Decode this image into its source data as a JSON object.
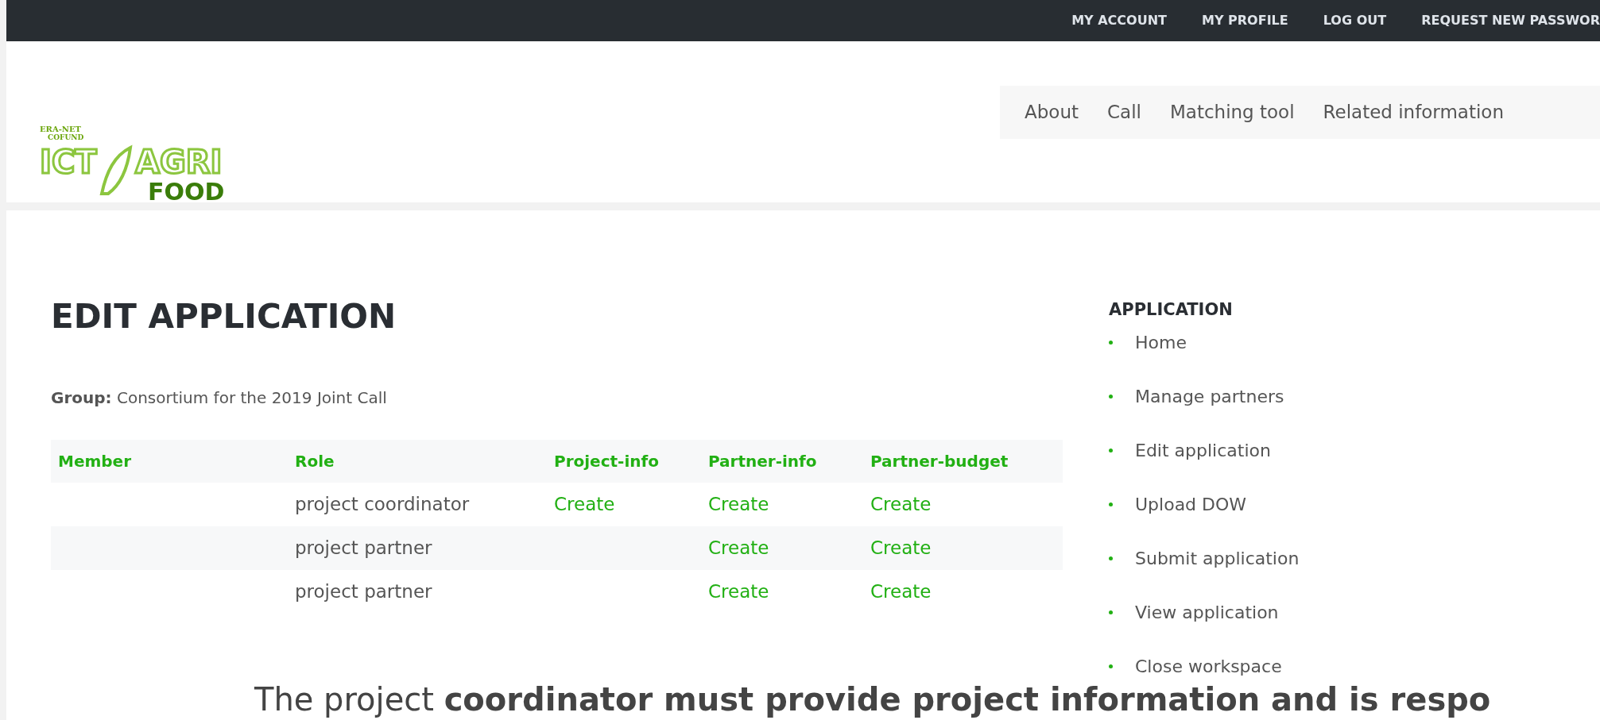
{
  "top_bar": {
    "links": [
      "MY ACCOUNT",
      "MY PROFILE",
      "LOG OUT",
      "REQUEST NEW PASSWOR"
    ]
  },
  "logo": {
    "small_lines": [
      "ERA-NET",
      "COFUND"
    ],
    "left": "ICT",
    "right": "AGRI",
    "bottom": "FOOD"
  },
  "nav": {
    "items": [
      "About",
      "Call",
      "Matching tool",
      "Related information"
    ]
  },
  "page": {
    "title": "EDIT APPLICATION",
    "group_label": "Group:",
    "group_value": "Consortium for the 2019 Joint Call"
  },
  "table": {
    "columns": [
      "Member",
      "Role",
      "Project-info",
      "Partner-info",
      "Partner-budget"
    ],
    "rows": [
      {
        "cells": [
          "",
          "project coordinator",
          "Create",
          "Create",
          "Create"
        ]
      },
      {
        "cells": [
          "",
          "project partner",
          "",
          "Create",
          "Create"
        ]
      },
      {
        "cells": [
          "",
          "project partner",
          "",
          "Create",
          "Create"
        ]
      }
    ]
  },
  "sidebar": {
    "title": "APPLICATION",
    "items": [
      "Home",
      "Manage partners",
      "Edit application",
      "Upload DOW",
      "Submit application",
      "View application",
      "Close workspace"
    ]
  },
  "caption": "The project **coordinator must provide project information and is respo**"
}
